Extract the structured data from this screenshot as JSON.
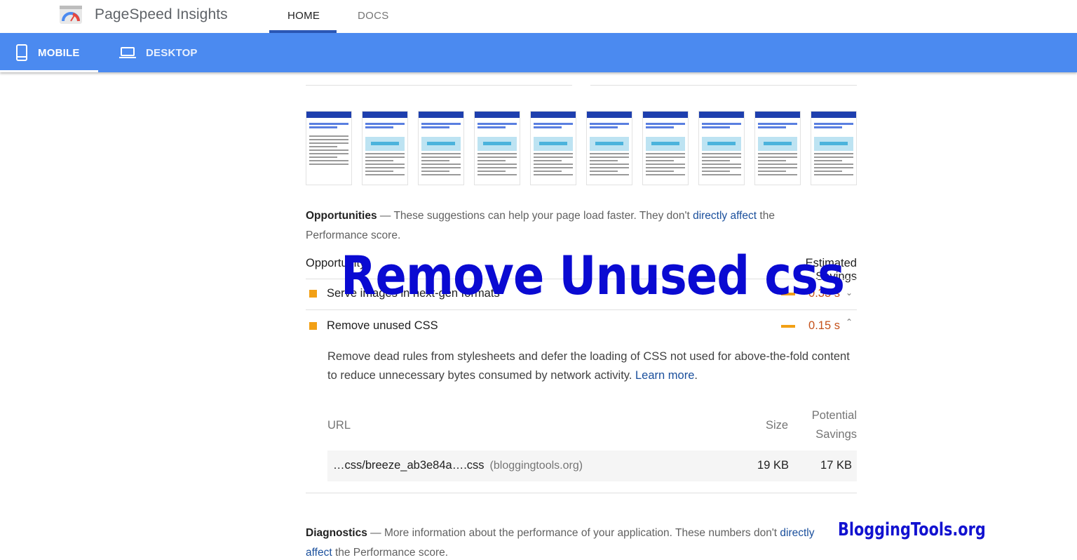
{
  "header": {
    "app_title": "PageSpeed Insights",
    "logo_icon": "pagespeed-gauge-icon",
    "tabs": [
      {
        "label": "HOME",
        "active": true
      },
      {
        "label": "DOCS",
        "active": false
      }
    ]
  },
  "device_bar": {
    "color": "#4b8af0",
    "tabs": [
      {
        "label": "MOBILE",
        "icon": "smartphone-icon",
        "active": true
      },
      {
        "label": "DESKTOP",
        "icon": "laptop-icon",
        "active": false
      }
    ]
  },
  "filmstrip": {
    "frame_count": 10
  },
  "opportunities": {
    "heading": "Opportunities",
    "text_before_link": " — These suggestions can help your page load faster. They don't ",
    "link_text": "directly affect",
    "text_after_link": " the Performance score.",
    "column_left": "Opportunity",
    "column_right": "Estimated Savings",
    "audits": [
      {
        "label": "Serve images in next-gen formats",
        "value": "0.33 s",
        "chevron": "chevron-down-icon",
        "expanded": false,
        "color": "#f2a015"
      },
      {
        "label": "Remove unused CSS",
        "value": "0.15 s",
        "chevron": "chevron-up-icon",
        "expanded": true,
        "color": "#f2a015"
      }
    ],
    "detail": {
      "description": "Remove dead rules from stylesheets and defer the loading of CSS not used for above-the-fold content to reduce unnecessary bytes consumed by network activity. ",
      "learn_more": "Learn more",
      "learn_more_suffix": ".",
      "columns": {
        "url": "URL",
        "size": "Size",
        "savings_line1": "Potential",
        "savings_line2": "Savings"
      },
      "rows": [
        {
          "url": "…css/breeze_ab3e84a….css",
          "host": "(bloggingtools.org)",
          "size": "19 KB",
          "savings": "17 KB"
        }
      ]
    }
  },
  "diagnostics": {
    "heading": "Diagnostics",
    "text_before_link": " — More information about the performance of your application. These numbers don't ",
    "link_text_1": "directly",
    "link_text_2": "affect",
    "text_after_link": " the Performance score."
  },
  "overlays": {
    "title": "Remove Unused css",
    "brand": "BloggingTools.org"
  }
}
